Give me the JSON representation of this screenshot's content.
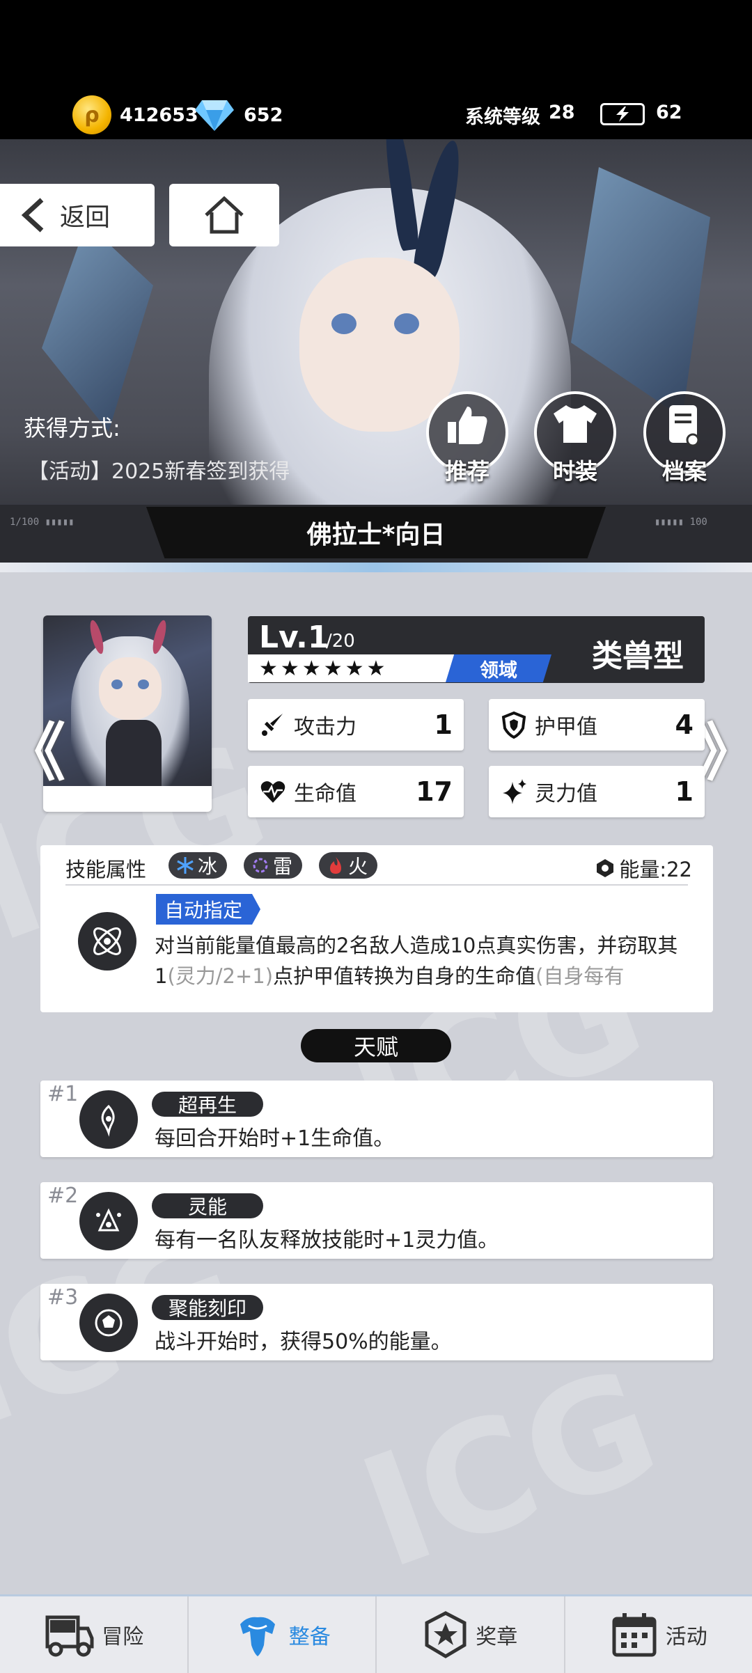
{
  "topbar": {
    "coins": "412653",
    "gems": "652",
    "system_level_label": "系统等级",
    "system_level": "28",
    "energy": "62"
  },
  "hero": {
    "back_label": "返回",
    "obtain_label": "获得方式:",
    "obtain_text": "【活动】2025新春签到获得",
    "buttons": [
      {
        "label": "推荐",
        "icon": "thumbs-up-icon"
      },
      {
        "label": "时装",
        "icon": "tshirt-icon"
      },
      {
        "label": "档案",
        "icon": "file-music-icon"
      }
    ],
    "character_name": "佛拉士*向日"
  },
  "card": {
    "level": "Lv.1",
    "level_max": "/20",
    "stars": 6,
    "domain_tag": "领域",
    "type": "类兽型",
    "stats": [
      {
        "label": "攻击力",
        "value": "1",
        "icon": "sword-icon"
      },
      {
        "label": "护甲值",
        "value": "4",
        "icon": "shield-icon"
      },
      {
        "label": "生命值",
        "value": "17",
        "icon": "heart-icon"
      },
      {
        "label": "灵力值",
        "value": "1",
        "icon": "sparkle-icon"
      }
    ]
  },
  "skill": {
    "header": "技能属性",
    "elements": [
      {
        "label": "冰",
        "color": "#4fa3ff"
      },
      {
        "label": "雷",
        "color": "#a27cf2"
      },
      {
        "label": "火",
        "color": "#e23c3c"
      }
    ],
    "energy_label": "能量:22",
    "target_tag": "自动指定",
    "desc_main": "对当前能量值最高的2名敌人造成10点真实伤害，并窃取其1",
    "desc_grey1": "(灵力/2+1)",
    "desc_mid": "点护甲值转换为自身的生命值",
    "desc_grey2": "(自身每有"
  },
  "talents": {
    "title": "天赋",
    "items": [
      {
        "num": "#1",
        "name": "超再生",
        "desc": "每回合开始时+1生命值。"
      },
      {
        "num": "#2",
        "name": "灵能",
        "desc": "每有一名队友释放技能时+1灵力值。"
      },
      {
        "num": "#3",
        "name": "聚能刻印",
        "desc": "战斗开始时，获得50%的能量。"
      }
    ]
  },
  "nav": {
    "tabs": [
      {
        "label": "冒险",
        "icon": "truck-icon"
      },
      {
        "label": "整备",
        "icon": "armor-icon"
      },
      {
        "label": "奖章",
        "icon": "medal-icon"
      },
      {
        "label": "活动",
        "icon": "calendar-icon"
      }
    ],
    "active": 1,
    "active_color": "#2a8ae0"
  }
}
